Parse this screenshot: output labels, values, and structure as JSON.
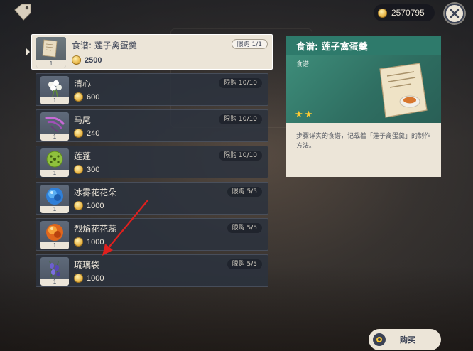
{
  "header": {
    "tag_icon": "price-tag-icon",
    "currency_icon": "mora-coin-icon",
    "currency_amount": "2570795",
    "close_icon": "close-icon"
  },
  "items": [
    {
      "name": "食谱: 莲子禽蛋羹",
      "price": "2500",
      "limit": "限购 1/1",
      "qty": "1",
      "icon": "recipe-scroll-icon",
      "selected": true
    },
    {
      "name": "清心",
      "price": "600",
      "limit": "限购 10/10",
      "qty": "1",
      "icon": "qingxin-flower-icon",
      "selected": false
    },
    {
      "name": "马尾",
      "price": "240",
      "limit": "限购 10/10",
      "qty": "1",
      "icon": "horsetail-plant-icon",
      "selected": false
    },
    {
      "name": "莲蓬",
      "price": "300",
      "limit": "限购 10/10",
      "qty": "1",
      "icon": "lotus-head-icon",
      "selected": false
    },
    {
      "name": "冰雾花花朵",
      "price": "1000",
      "limit": "限购 5/5",
      "qty": "1",
      "icon": "mist-flower-icon",
      "selected": false
    },
    {
      "name": "烈焰花花蕊",
      "price": "1000",
      "limit": "限购 5/5",
      "qty": "1",
      "icon": "flaming-flower-icon",
      "selected": false
    },
    {
      "name": "琉璃袋",
      "price": "1000",
      "limit": "限购 5/5",
      "qty": "1",
      "icon": "glaze-lily-bag-icon",
      "selected": false
    }
  ],
  "detail": {
    "title": "食谱: 莲子禽蛋羹",
    "type": "食谱",
    "icon": "recipe-scroll-icon",
    "rarity_stars": 2,
    "description": "步骤详实的食谱，记载着「莲子禽蛋羹」的制作方法。"
  },
  "buy_button": {
    "label": "购买",
    "icon": "purchase-circle-icon"
  },
  "colors": {
    "accent_teal": "#2e7a6b",
    "panel_cream": "#ece5d8",
    "star_gold": "#ffcc32",
    "annotation_red": "#e0201e"
  }
}
